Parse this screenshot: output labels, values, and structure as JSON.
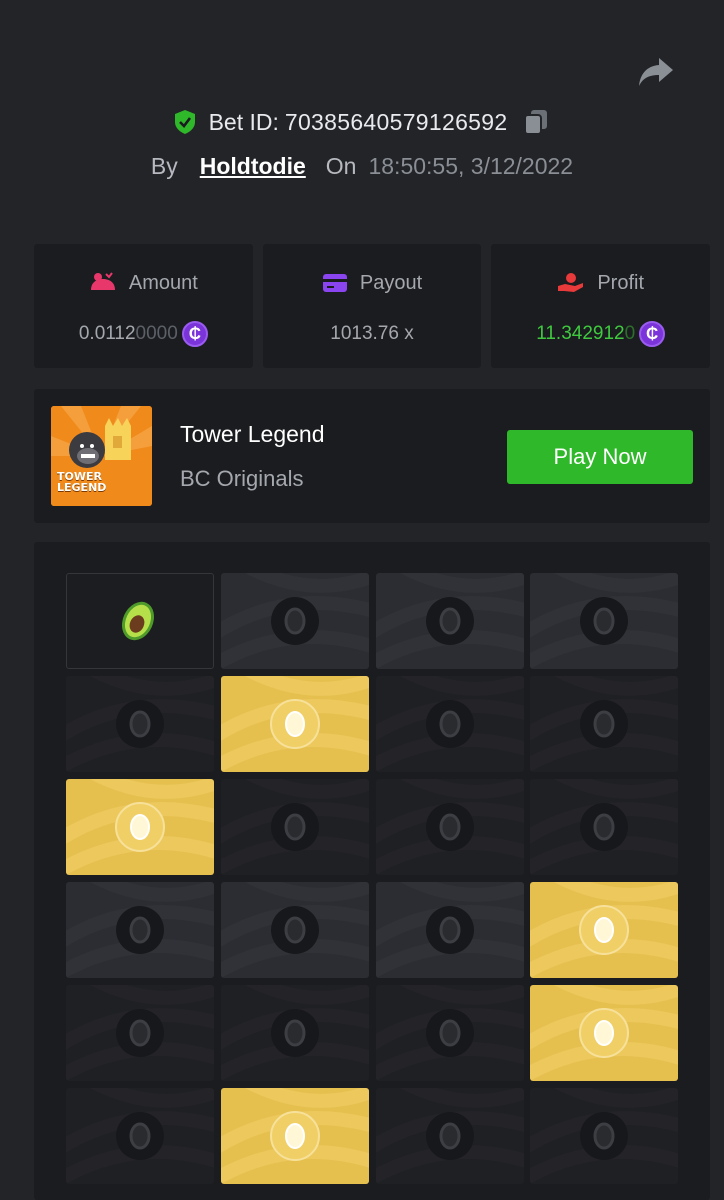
{
  "header": {
    "bet_id_label": "Bet ID:",
    "bet_id": "70385640579126592",
    "by_label": "By",
    "username": "Holdtodie",
    "on_label": "On",
    "timestamp": "18:50:55, 3/12/2022"
  },
  "stats": {
    "amount": {
      "label": "Amount",
      "value_main": "0.0112",
      "value_dim": "0000",
      "icon": "coin-bag-icon"
    },
    "payout": {
      "label": "Payout",
      "value": "1013.76 x",
      "icon": "card-icon"
    },
    "profit": {
      "label": "Profit",
      "value_main": "11.342912",
      "value_dim": "0",
      "icon": "hand-coin-icon"
    },
    "currency_symbol": "₵"
  },
  "game": {
    "name": "Tower Legend",
    "provider": "BC Originals",
    "play_label": "Play Now",
    "thumb_text_line1": "TOWER",
    "thumb_text_line2": "LEGEND"
  },
  "board": {
    "rows": [
      [
        "avocado",
        "grey",
        "grey",
        "grey"
      ],
      [
        "dark",
        "gold",
        "dark",
        "dark"
      ],
      [
        "gold",
        "dark",
        "dark",
        "dark"
      ],
      [
        "grey",
        "grey",
        "grey",
        "gold"
      ],
      [
        "dark",
        "dark",
        "dark",
        "gold"
      ],
      [
        "dark",
        "gold",
        "dark",
        "dark"
      ]
    ]
  },
  "colors": {
    "background": "#232428",
    "panel": "#1b1c1f",
    "accent_green": "#2fb82a",
    "profit_green": "#3fc93f",
    "coin_purple": "#7a34d9",
    "gold_tile": "#e6c04f"
  }
}
